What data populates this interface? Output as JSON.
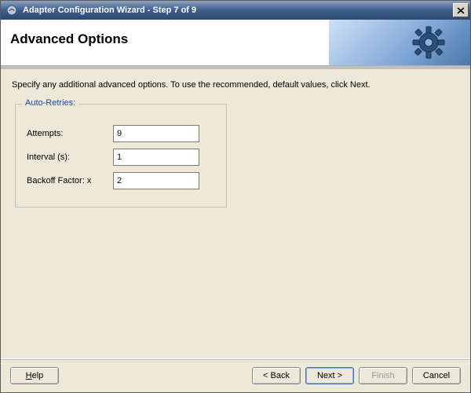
{
  "window": {
    "title": "Adapter Configuration Wizard - Step 7 of 9"
  },
  "banner": {
    "title": "Advanced Options"
  },
  "instruction": "Specify any additional advanced options.  To use the recommended, default values, click Next.",
  "group": {
    "legend": "Auto-Retries:",
    "attempts": {
      "label": "Attempts:",
      "value": "9"
    },
    "interval": {
      "label": "Interval (s):",
      "value": "1"
    },
    "backoff": {
      "label": "Backoff Factor: x",
      "value": "2"
    }
  },
  "buttons": {
    "help": "Help",
    "back": "< Back",
    "next": "Next >",
    "finish": "Finish",
    "cancel": "Cancel"
  }
}
